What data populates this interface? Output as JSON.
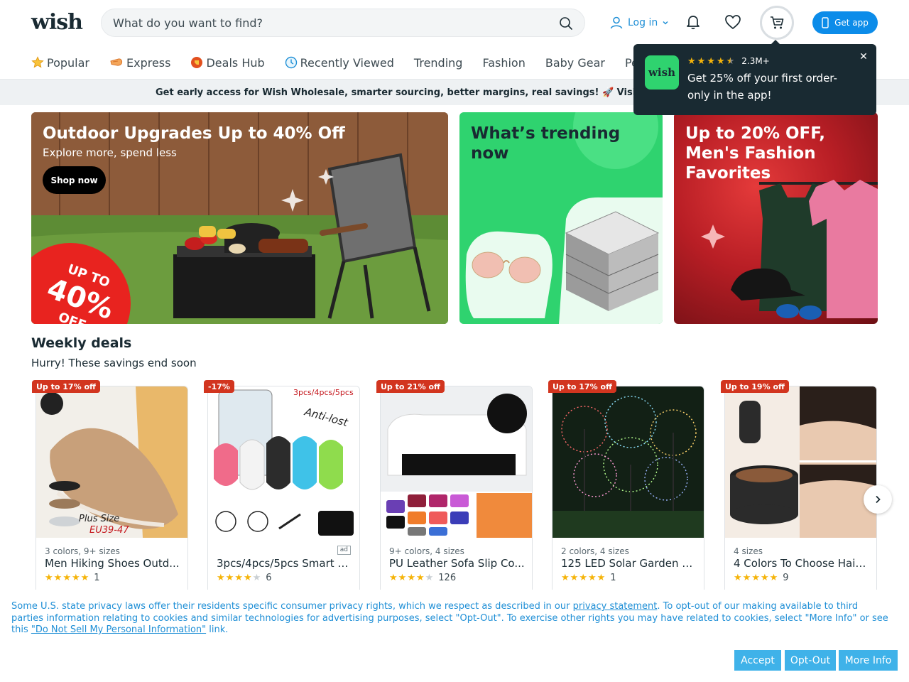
{
  "header": {
    "logo": "wish",
    "search_placeholder": "What do you want to find?",
    "login_label": "Log in",
    "get_app_label": "Get app"
  },
  "nav": {
    "items": [
      {
        "label": "Popular",
        "icon": "star-icon"
      },
      {
        "label": "Express",
        "icon": "express-icon"
      },
      {
        "label": "Deals Hub",
        "icon": "deals-icon"
      },
      {
        "label": "Recently Viewed",
        "icon": "clock-icon"
      },
      {
        "label": "Trending"
      },
      {
        "label": "Fashion"
      },
      {
        "label": "Baby Gear"
      },
      {
        "label": "Pet Ac"
      }
    ]
  },
  "banner": {
    "text": "Get early access for Wish Wholesale, smarter sourcing, better margins, real savings! 🚀 Visit ht"
  },
  "popup": {
    "logo": "wish",
    "rating": 4.5,
    "count": "2.3M+",
    "text": "Get 25% off your first order- only in the app!"
  },
  "heroes": [
    {
      "title": "Outdoor Upgrades Up to 40% Off",
      "subtitle": "Explore more, spend less",
      "button": "Shop now",
      "badge_up": "UP TO",
      "badge_num": "40%",
      "badge_off": "OFF"
    },
    {
      "title": "What’s trending now"
    },
    {
      "title": "Up to 20% OFF, Men's Fashion Favorites"
    }
  ],
  "weekly_deals": {
    "title": "Weekly deals",
    "subtitle": "Hurry! These savings end soon",
    "cards": [
      {
        "badge": "Up to 17% off",
        "variants": "3 colors, 9+ sizes",
        "title": "Men Hiking Shoes Outd...",
        "stars": 5,
        "count": "1"
      },
      {
        "badge": "-17%",
        "variants": "",
        "title": "3pcs/4pcs/5pcs Smart T...",
        "stars": 4,
        "count": "6",
        "ad": "ad"
      },
      {
        "badge": "Up to 21% off",
        "variants": "9+ colors, 4 sizes",
        "title": "PU Leather Sofa Slip Co...",
        "stars": 4,
        "count": "126"
      },
      {
        "badge": "Up to 17% off",
        "variants": "2 colors, 4 sizes",
        "title": "125 LED Solar Garden Li...",
        "stars": 5,
        "count": "1"
      },
      {
        "badge": "Up to 19% off",
        "variants": "4 sizes",
        "title": "4 Colors To Choose Hair ...",
        "stars": 5,
        "count": "9"
      }
    ]
  },
  "privacy": {
    "text_1": "Some U.S. state privacy laws offer their residents specific consumer privacy rights, which we respect as described in our ",
    "link_1": "privacy statement",
    "text_2": ". To opt-out of our making available to third parties information relating to cookies and similar technologies for advertising purposes, select \"Opt-Out\". To exercise other rights you may have related to cookies, select \"More Info\" or see this ",
    "link_2": "\"Do Not Sell My Personal Information\"",
    "text_3": " link.",
    "accept": "Accept",
    "opt_out": "Opt-Out",
    "more_info": "More Info"
  },
  "colors": {
    "brand_blue": "#0c8ce9",
    "green": "#2fd36f",
    "badge_red": "#d2351f",
    "dark": "#192a32"
  }
}
